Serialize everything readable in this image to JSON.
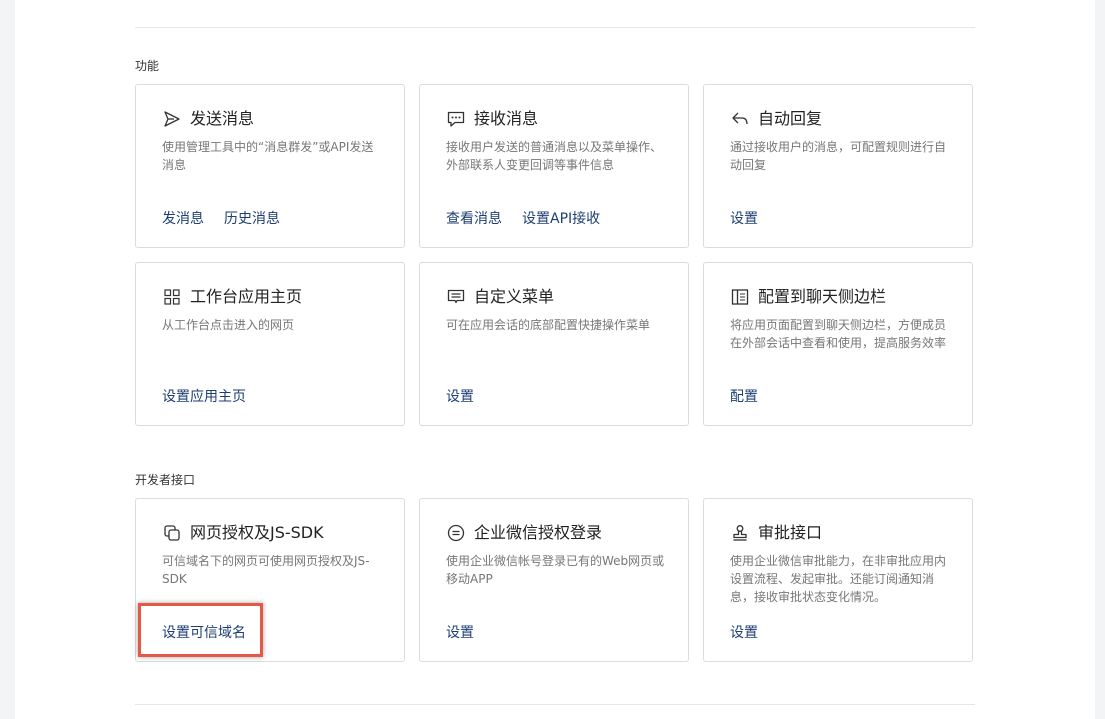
{
  "sections": {
    "features_title": "功能",
    "developer_title": "开发者接口"
  },
  "cards": {
    "send": {
      "icon": "send-icon",
      "title": "发送消息",
      "desc": "使用管理工具中的“消息群发”或API发送消息",
      "actions": [
        "发消息",
        "历史消息"
      ]
    },
    "receive": {
      "icon": "chat-bubble-icon",
      "title": "接收消息",
      "desc": "接收用户发送的普通消息以及菜单操作、外部联系人变更回调等事件信息",
      "actions": [
        "查看消息",
        "设置API接收"
      ]
    },
    "autoreply": {
      "icon": "reply-arrow-icon",
      "title": "自动回复",
      "desc": "通过接收用户的消息，可配置规则进行自动回复",
      "actions": [
        "设置"
      ]
    },
    "workbench": {
      "icon": "grid-icon",
      "title": "工作台应用主页",
      "desc": "从工作台点击进入的网页",
      "actions": [
        "设置应用主页"
      ]
    },
    "menu": {
      "icon": "menu-icon",
      "title": "自定义菜单",
      "desc": "可在应用会话的底部配置快捷操作菜单",
      "actions": [
        "设置"
      ]
    },
    "sidebar": {
      "icon": "sidebar-icon",
      "title": "配置到聊天侧边栏",
      "desc": "将应用页面配置到聊天侧边栏，方便成员在外部会话中查看和使用，提高服务效率",
      "actions": [
        "配置"
      ]
    },
    "oauth": {
      "icon": "copy-pages-icon",
      "title": "网页授权及JS-SDK",
      "desc": "可信域名下的网页可使用网页授权及JS-SDK",
      "actions": [
        "设置可信域名"
      ]
    },
    "login": {
      "icon": "equals-circle-icon",
      "title": "企业微信授权登录",
      "desc": "使用企业微信帐号登录已有的Web网页或移动APP",
      "actions": [
        "设置"
      ]
    },
    "approval": {
      "icon": "stamp-icon",
      "title": "审批接口",
      "desc": "使用企业微信审批能力，在非审批应用内设置流程、发起审批。还能订阅通知消息，接收审批状态变化情况。",
      "actions": [
        "设置"
      ]
    }
  },
  "colors": {
    "link": "#1d3e73",
    "highlight": "#e45845"
  }
}
